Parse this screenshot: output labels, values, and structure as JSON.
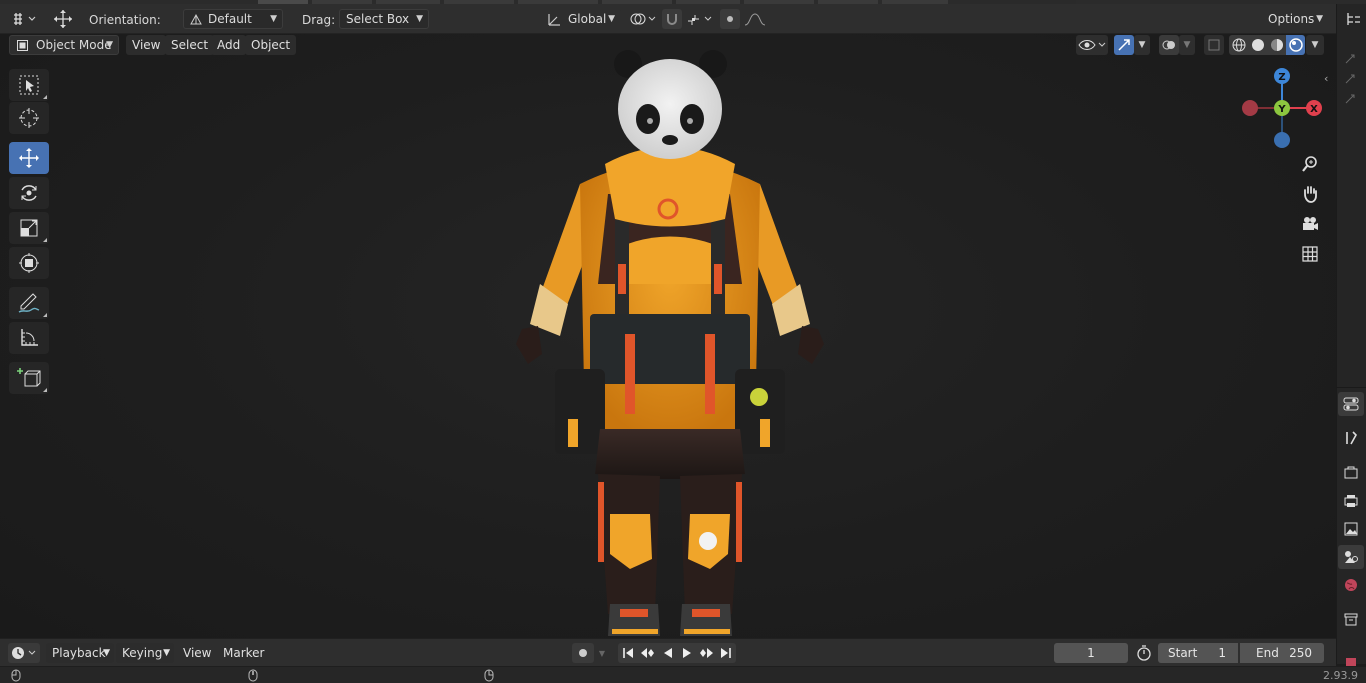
{
  "header": {
    "orientation_label": "Orientation:",
    "orientation_value": "Default",
    "drag_label": "Drag:",
    "drag_value": "Select Box",
    "transform_space": "Global",
    "options_label": "Options"
  },
  "viewport_header": {
    "mode": "Object Mode",
    "menus": [
      "View",
      "Select",
      "Add",
      "Object"
    ]
  },
  "gizmo": {
    "z_label": "Z",
    "y_label": "Y",
    "x_label": "X",
    "colors": {
      "x": "#e0404d",
      "y": "#8cc63f",
      "z": "#3d86d8"
    }
  },
  "toolbar": {
    "tools": [
      "select-box-tool",
      "cursor-tool",
      "move-tool",
      "rotate-tool",
      "scale-tool",
      "transform-tool",
      "annotate-tool",
      "measure-tool",
      "add-cube-tool"
    ],
    "active": "move-tool"
  },
  "navigation": [
    "zoom-icon",
    "hand-pan-icon",
    "camera-icon",
    "ortho-grid-icon"
  ],
  "timeline": {
    "menus": [
      "Playback",
      "Keying",
      "View",
      "Marker"
    ],
    "current_frame": "1",
    "start_label": "Start",
    "start_value": "1",
    "end_label": "End",
    "end_value": "250"
  },
  "status": {
    "version": "2.93.9"
  },
  "accent_color": "#4772b3"
}
